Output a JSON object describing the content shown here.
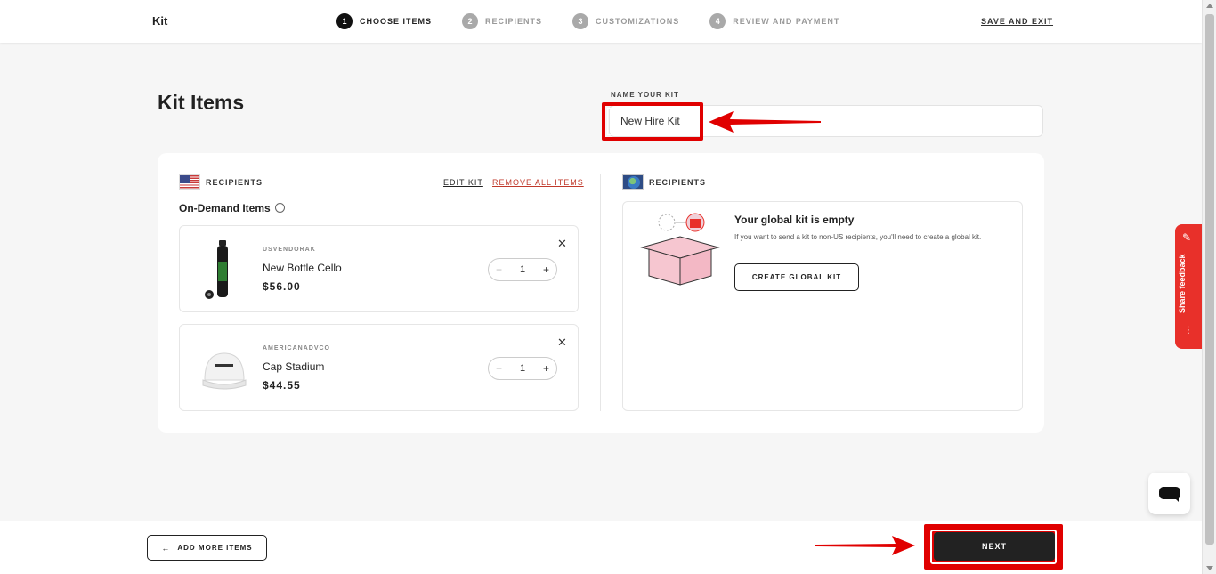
{
  "header": {
    "brand": "Kit",
    "steps": [
      {
        "num": "1",
        "label": "CHOOSE ITEMS"
      },
      {
        "num": "2",
        "label": "RECIPIENTS"
      },
      {
        "num": "3",
        "label": "CUSTOMIZATIONS"
      },
      {
        "num": "4",
        "label": "REVIEW AND PAYMENT"
      }
    ],
    "save_exit": "SAVE AND EXIT"
  },
  "page": {
    "title": "Kit Items",
    "name_label": "NAME YOUR KIT",
    "name_value": "New Hire Kit"
  },
  "us_section": {
    "recipients_label": "RECIPIENTS",
    "edit_kit": "EDIT KIT",
    "remove_all": "REMOVE ALL ITEMS",
    "ondemand_label": "On-Demand Items",
    "info_icon": "i",
    "items": [
      {
        "vendor": "USVENDORAK",
        "name": "New Bottle Cello",
        "price": "$56.00",
        "qty": "1",
        "minus": "−",
        "plus": "+",
        "close": "✕"
      },
      {
        "vendor": "AMERICANADVCO",
        "name": "Cap Stadium",
        "price": "$44.55",
        "qty": "1",
        "minus": "−",
        "plus": "+",
        "close": "✕"
      }
    ]
  },
  "global_section": {
    "recipients_label": "RECIPIENTS",
    "empty_title": "Your global kit is empty",
    "empty_desc": "If you want to send a kit to non-US recipients, you'll need to create a global kit.",
    "create_button": "CREATE GLOBAL KIT"
  },
  "feedback": {
    "label": "Share feedback",
    "dots": "⋮"
  },
  "footer": {
    "add_more": "ADD MORE ITEMS",
    "add_arrow": "←",
    "next": "NEXT"
  },
  "colors": {
    "annotation_red": "#e00000",
    "feedback_red": "#e8302a",
    "dark": "#222222",
    "remove_red": "#c0392b"
  }
}
